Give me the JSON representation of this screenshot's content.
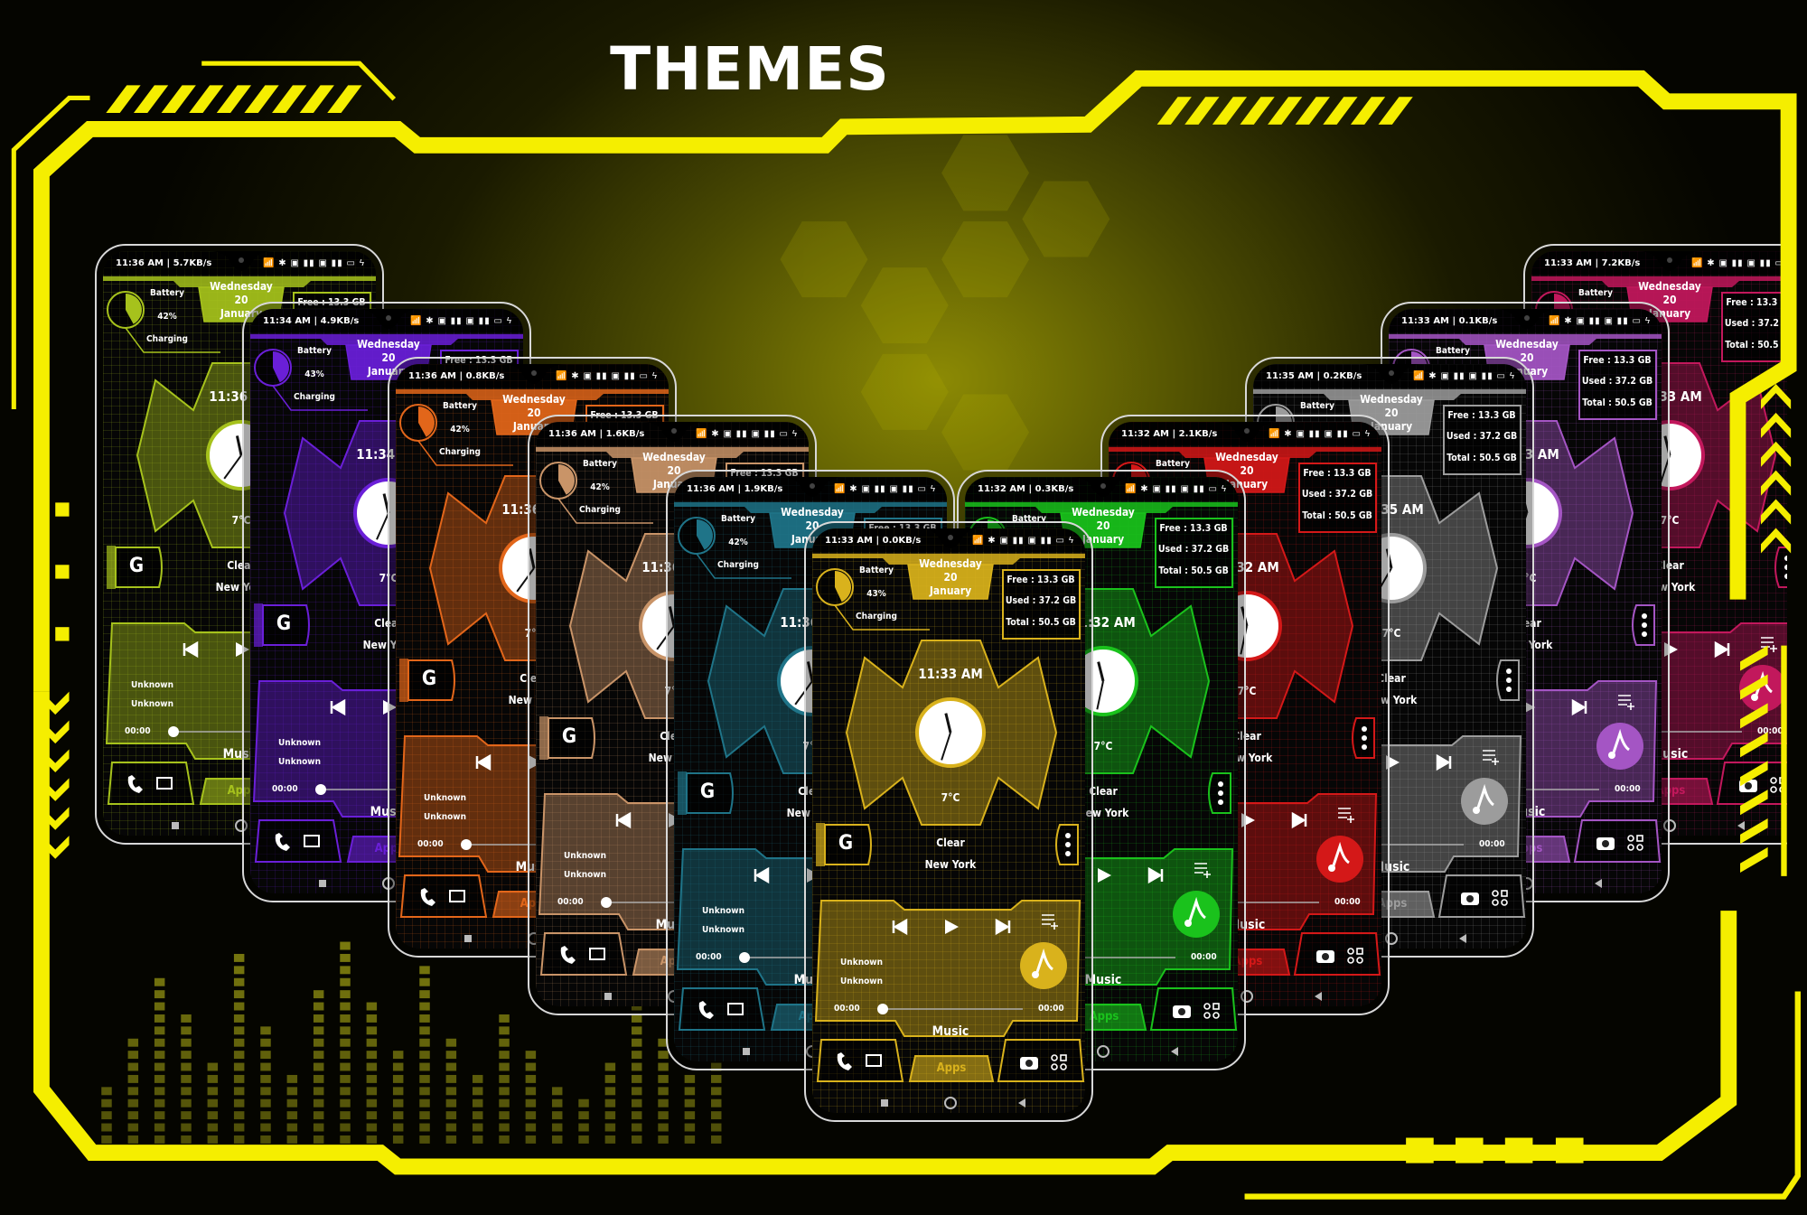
{
  "title": "THEMES",
  "widget": {
    "battery_label": "Battery",
    "charging_label": "Charging",
    "weekday": "Wednesday",
    "day": "20",
    "month": "January",
    "free": "Free : 13.3 GB",
    "used": "Used : 37.2 GB",
    "total": "Total : 50.5 GB",
    "temperature": "7°C",
    "weather": "Clear",
    "city": "New York",
    "google_label": "G",
    "track_title": "Unknown",
    "track_artist": "Unknown",
    "elapsed": "00:00",
    "duration": "00:00",
    "music_label": "Music",
    "apps_label": "Apps",
    "status_icons": "📶 ✱ ▣ ▮▮ ▣ ▮▮ ▭ ϟ"
  },
  "phones": [
    {
      "theme": "olive",
      "color": "#a6c21c",
      "status": "11:36 AM | 5.7KB/s",
      "battery": "42%",
      "battery_level": 0.42,
      "clock_time": "11:36 AM"
    },
    {
      "theme": "purple",
      "color": "#6a1fd8",
      "status": "11:34 AM | 4.9KB/s",
      "battery": "43%",
      "battery_level": 0.43,
      "clock_time": "11:34 AM"
    },
    {
      "theme": "orange",
      "color": "#e2661a",
      "status": "11:36 AM | 0.8KB/s",
      "battery": "42%",
      "battery_level": 0.42,
      "clock_time": "11:36 AM"
    },
    {
      "theme": "tan",
      "color": "#c99468",
      "status": "11:36 AM | 1.6KB/s",
      "battery": "42%",
      "battery_level": 0.42,
      "clock_time": "11:36 AM"
    },
    {
      "theme": "teal",
      "color": "#1f7488",
      "status": "11:36 AM | 1.9KB/s",
      "battery": "42%",
      "battery_level": 0.42,
      "clock_time": "11:36 AM"
    },
    {
      "theme": "yellow",
      "color": "#d9b21c",
      "status": "11:33 AM | 0.0KB/s",
      "battery": "43%",
      "battery_level": 0.43,
      "clock_time": "11:33 AM"
    },
    {
      "theme": "green",
      "color": "#1ac21c",
      "status": "11:32 AM | 0.3KB/s",
      "battery": null,
      "battery_level": 0.43,
      "clock_time": "11:32 AM"
    },
    {
      "theme": "red",
      "color": "#d41818",
      "status": "11:32 AM | 2.1KB/s",
      "battery": null,
      "battery_level": 0.43,
      "clock_time": "11:32 AM"
    },
    {
      "theme": "gray",
      "color": "#9c9c9c",
      "status": "11:35 AM | 0.2KB/s",
      "battery": null,
      "battery_level": 0.43,
      "clock_time": "11:35 AM"
    },
    {
      "theme": "violet",
      "color": "#a455c4",
      "status": "11:33 AM | 0.1KB/s",
      "battery": null,
      "battery_level": 0.43,
      "clock_time": "11:33 AM"
    },
    {
      "theme": "magenta",
      "color": "#c2185c",
      "status": "11:33 AM | 7.2KB/s",
      "battery": null,
      "battery_level": 0.43,
      "clock_time": "11:33 AM"
    }
  ],
  "colors": {
    "frame": "#f5ee00",
    "background": "#000000"
  }
}
